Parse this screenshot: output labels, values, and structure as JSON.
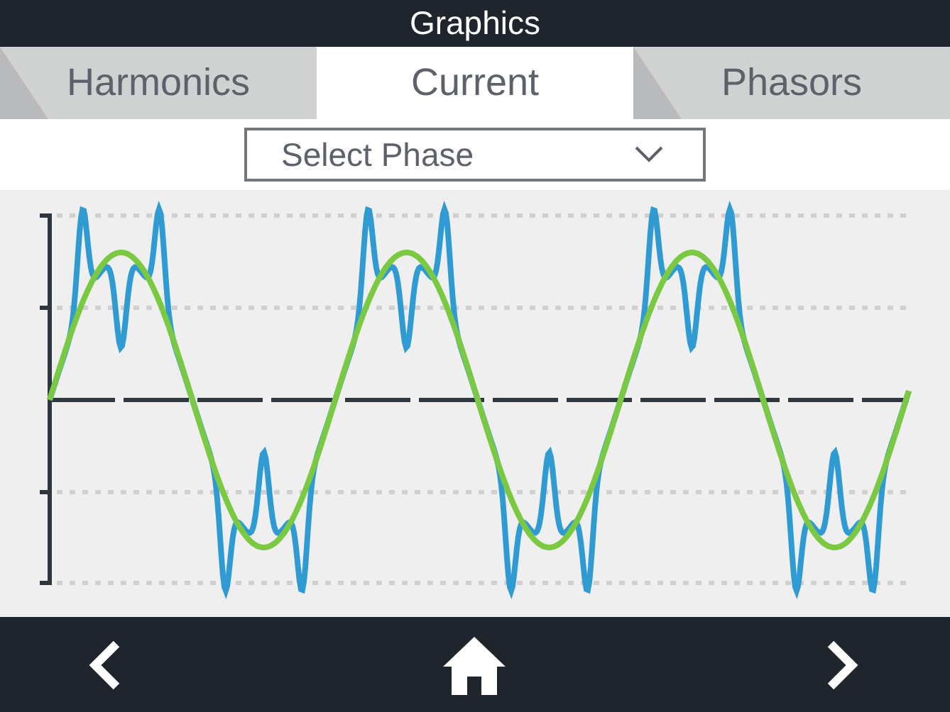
{
  "window": {
    "title": "Graphics"
  },
  "tabs": [
    {
      "label": "Harmonics",
      "selected": false
    },
    {
      "label": "Current",
      "selected": true
    },
    {
      "label": "Phasors",
      "selected": false
    }
  ],
  "phase_select": {
    "value": "Select Phase"
  }
}
